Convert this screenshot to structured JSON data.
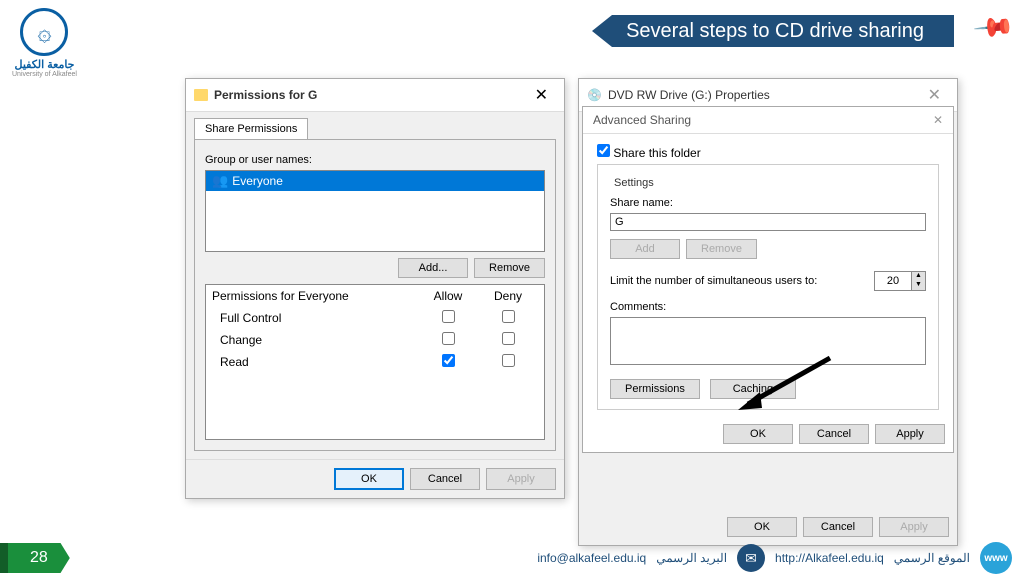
{
  "slide": {
    "title": "Several steps to CD drive sharing",
    "number": "28"
  },
  "logo": {
    "ar": "جامعة الكفيل",
    "en": "University of Alkafeel"
  },
  "perm_dialog": {
    "title": "Permissions for G",
    "tab": "Share Permissions",
    "group_label": "Group or user names:",
    "items": [
      "Everyone"
    ],
    "add_btn": "Add...",
    "remove_btn": "Remove",
    "perm_for": "Permissions for Everyone",
    "allow": "Allow",
    "deny": "Deny",
    "rows": [
      {
        "name": "Full Control",
        "allow": false,
        "deny": false
      },
      {
        "name": "Change",
        "allow": false,
        "deny": false
      },
      {
        "name": "Read",
        "allow": true,
        "deny": false
      }
    ],
    "ok": "OK",
    "cancel": "Cancel",
    "apply": "Apply"
  },
  "prop_dialog": {
    "title": "DVD RW Drive (G:) Properties"
  },
  "adv_dialog": {
    "title": "Advanced Sharing",
    "share_chk": "Share this folder",
    "settings": "Settings",
    "share_name_lbl": "Share name:",
    "share_name": "G",
    "add": "Add",
    "remove": "Remove",
    "limit_lbl": "Limit the number of simultaneous users to:",
    "limit_val": "20",
    "comments_lbl": "Comments:",
    "perm_btn": "Permissions",
    "cache_btn": "Caching",
    "ok": "OK",
    "cancel": "Cancel",
    "apply": "Apply"
  },
  "footer": {
    "email": "info@alkafeel.edu.iq",
    "email_lbl": "البريد الرسمي",
    "site": "http://Alkafeel.edu.iq",
    "site_lbl": "الموقع الرسمي"
  }
}
